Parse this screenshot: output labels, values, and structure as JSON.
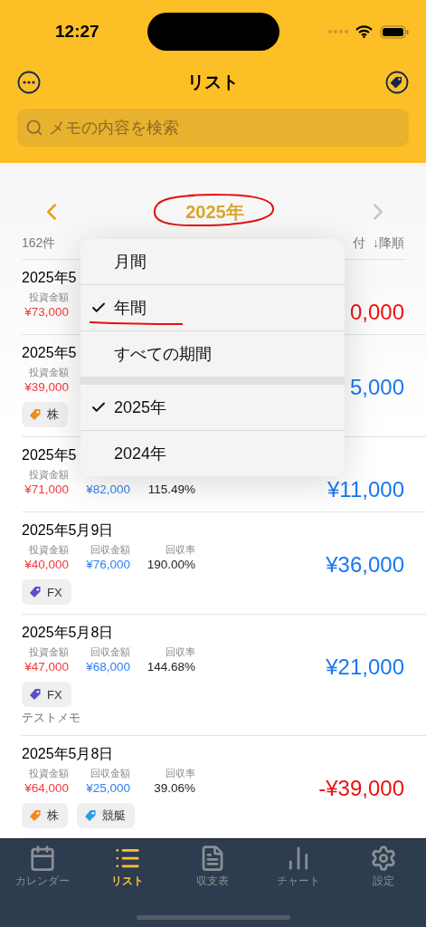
{
  "status_bar": {
    "time": "12:27"
  },
  "nav": {
    "title": "リスト"
  },
  "search": {
    "placeholder": "メモの内容を検索"
  },
  "period": {
    "title": "2025年"
  },
  "list_header": {
    "count": "162件",
    "sort_field": "付",
    "sort_order": "↓降順"
  },
  "rows": [
    {
      "date": "2025年5",
      "metrics": [
        {
          "kind": "invest",
          "label": "投資金額",
          "value": "¥73,000"
        }
      ],
      "tags": [],
      "amount": "0,000",
      "color": "#ee1010"
    },
    {
      "date": "2025年5",
      "metrics": [
        {
          "kind": "invest",
          "label": "投資金額",
          "value": "¥39,000"
        }
      ],
      "tags": [
        {
          "label": "株",
          "color": "#f08a24"
        }
      ],
      "amount": "5,000",
      "color": "#1877f2"
    },
    {
      "date": "2025年5",
      "metrics": [
        {
          "kind": "invest",
          "label": "投資金額",
          "value": "¥71,000"
        },
        {
          "kind": "return",
          "value": "¥82,000"
        },
        {
          "kind": "rate",
          "value": "115.49%"
        }
      ],
      "tags": [],
      "amount": "¥11,000",
      "color": "#1877f2"
    },
    {
      "date": "2025年5月9日",
      "metrics": [
        {
          "kind": "invest",
          "label": "投資金額",
          "value": "¥40,000"
        },
        {
          "kind": "return",
          "label": "回収金額",
          "value": "¥76,000"
        },
        {
          "kind": "rate",
          "label": "回収率",
          "value": "190.00%"
        }
      ],
      "tags": [
        {
          "label": "FX",
          "color": "#5a4fcf"
        }
      ],
      "amount": "¥36,000",
      "color": "#1877f2"
    },
    {
      "date": "2025年5月8日",
      "metrics": [
        {
          "kind": "invest",
          "label": "投資金額",
          "value": "¥47,000"
        },
        {
          "kind": "return",
          "label": "回収金額",
          "value": "¥68,000"
        },
        {
          "kind": "rate",
          "label": "回収率",
          "value": "144.68%"
        }
      ],
      "tags": [
        {
          "label": "FX",
          "color": "#5a4fcf"
        }
      ],
      "memo": "テストメモ",
      "amount": "¥21,000",
      "color": "#1877f2"
    },
    {
      "date": "2025年5月8日",
      "metrics": [
        {
          "kind": "invest",
          "label": "投資金額",
          "value": "¥64,000"
        },
        {
          "kind": "return",
          "label": "回収金額",
          "value": "¥25,000"
        },
        {
          "kind": "rate",
          "label": "回収率",
          "value": "39.06%"
        }
      ],
      "tags": [
        {
          "label": "株",
          "color": "#f08a24"
        },
        {
          "label": "競艇",
          "color": "#2f9ee8"
        }
      ],
      "amount": "-¥39,000",
      "color": "#ee1010"
    }
  ],
  "menu": {
    "groups": [
      [
        {
          "label": "月間",
          "selected": false
        },
        {
          "label": "年間",
          "selected": true
        },
        {
          "label": "すべての期間",
          "selected": false
        }
      ],
      [
        {
          "label": "2025年",
          "selected": true
        },
        {
          "label": "2024年",
          "selected": false
        }
      ]
    ]
  },
  "tab_bar": [
    {
      "kind": "calendar",
      "label": "カレンダー",
      "selected": false
    },
    {
      "kind": "list",
      "label": "リスト",
      "selected": true
    },
    {
      "kind": "document",
      "label": "収支表",
      "selected": false
    },
    {
      "kind": "chart",
      "label": "チャート",
      "selected": false
    },
    {
      "kind": "settings",
      "label": "設定",
      "selected": false
    }
  ]
}
